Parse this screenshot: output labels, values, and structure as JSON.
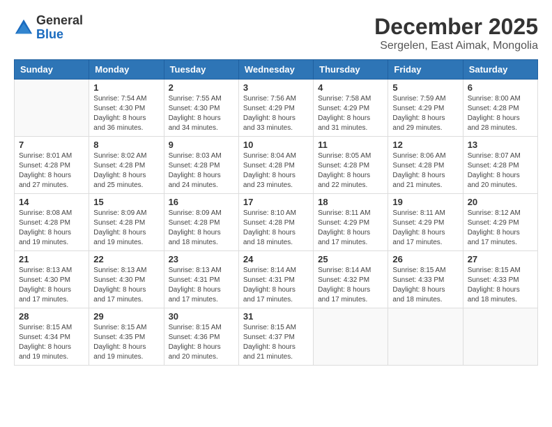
{
  "header": {
    "logo_general": "General",
    "logo_blue": "Blue",
    "month_title": "December 2025",
    "subtitle": "Sergelen, East Aimak, Mongolia"
  },
  "weekdays": [
    "Sunday",
    "Monday",
    "Tuesday",
    "Wednesday",
    "Thursday",
    "Friday",
    "Saturday"
  ],
  "weeks": [
    [
      {
        "day": "",
        "sunrise": "",
        "sunset": "",
        "daylight": ""
      },
      {
        "day": "1",
        "sunrise": "Sunrise: 7:54 AM",
        "sunset": "Sunset: 4:30 PM",
        "daylight": "Daylight: 8 hours and 36 minutes."
      },
      {
        "day": "2",
        "sunrise": "Sunrise: 7:55 AM",
        "sunset": "Sunset: 4:30 PM",
        "daylight": "Daylight: 8 hours and 34 minutes."
      },
      {
        "day": "3",
        "sunrise": "Sunrise: 7:56 AM",
        "sunset": "Sunset: 4:29 PM",
        "daylight": "Daylight: 8 hours and 33 minutes."
      },
      {
        "day": "4",
        "sunrise": "Sunrise: 7:58 AM",
        "sunset": "Sunset: 4:29 PM",
        "daylight": "Daylight: 8 hours and 31 minutes."
      },
      {
        "day": "5",
        "sunrise": "Sunrise: 7:59 AM",
        "sunset": "Sunset: 4:29 PM",
        "daylight": "Daylight: 8 hours and 29 minutes."
      },
      {
        "day": "6",
        "sunrise": "Sunrise: 8:00 AM",
        "sunset": "Sunset: 4:28 PM",
        "daylight": "Daylight: 8 hours and 28 minutes."
      }
    ],
    [
      {
        "day": "7",
        "sunrise": "Sunrise: 8:01 AM",
        "sunset": "Sunset: 4:28 PM",
        "daylight": "Daylight: 8 hours and 27 minutes."
      },
      {
        "day": "8",
        "sunrise": "Sunrise: 8:02 AM",
        "sunset": "Sunset: 4:28 PM",
        "daylight": "Daylight: 8 hours and 25 minutes."
      },
      {
        "day": "9",
        "sunrise": "Sunrise: 8:03 AM",
        "sunset": "Sunset: 4:28 PM",
        "daylight": "Daylight: 8 hours and 24 minutes."
      },
      {
        "day": "10",
        "sunrise": "Sunrise: 8:04 AM",
        "sunset": "Sunset: 4:28 PM",
        "daylight": "Daylight: 8 hours and 23 minutes."
      },
      {
        "day": "11",
        "sunrise": "Sunrise: 8:05 AM",
        "sunset": "Sunset: 4:28 PM",
        "daylight": "Daylight: 8 hours and 22 minutes."
      },
      {
        "day": "12",
        "sunrise": "Sunrise: 8:06 AM",
        "sunset": "Sunset: 4:28 PM",
        "daylight": "Daylight: 8 hours and 21 minutes."
      },
      {
        "day": "13",
        "sunrise": "Sunrise: 8:07 AM",
        "sunset": "Sunset: 4:28 PM",
        "daylight": "Daylight: 8 hours and 20 minutes."
      }
    ],
    [
      {
        "day": "14",
        "sunrise": "Sunrise: 8:08 AM",
        "sunset": "Sunset: 4:28 PM",
        "daylight": "Daylight: 8 hours and 19 minutes."
      },
      {
        "day": "15",
        "sunrise": "Sunrise: 8:09 AM",
        "sunset": "Sunset: 4:28 PM",
        "daylight": "Daylight: 8 hours and 19 minutes."
      },
      {
        "day": "16",
        "sunrise": "Sunrise: 8:09 AM",
        "sunset": "Sunset: 4:28 PM",
        "daylight": "Daylight: 8 hours and 18 minutes."
      },
      {
        "day": "17",
        "sunrise": "Sunrise: 8:10 AM",
        "sunset": "Sunset: 4:28 PM",
        "daylight": "Daylight: 8 hours and 18 minutes."
      },
      {
        "day": "18",
        "sunrise": "Sunrise: 8:11 AM",
        "sunset": "Sunset: 4:29 PM",
        "daylight": "Daylight: 8 hours and 17 minutes."
      },
      {
        "day": "19",
        "sunrise": "Sunrise: 8:11 AM",
        "sunset": "Sunset: 4:29 PM",
        "daylight": "Daylight: 8 hours and 17 minutes."
      },
      {
        "day": "20",
        "sunrise": "Sunrise: 8:12 AM",
        "sunset": "Sunset: 4:29 PM",
        "daylight": "Daylight: 8 hours and 17 minutes."
      }
    ],
    [
      {
        "day": "21",
        "sunrise": "Sunrise: 8:13 AM",
        "sunset": "Sunset: 4:30 PM",
        "daylight": "Daylight: 8 hours and 17 minutes."
      },
      {
        "day": "22",
        "sunrise": "Sunrise: 8:13 AM",
        "sunset": "Sunset: 4:30 PM",
        "daylight": "Daylight: 8 hours and 17 minutes."
      },
      {
        "day": "23",
        "sunrise": "Sunrise: 8:13 AM",
        "sunset": "Sunset: 4:31 PM",
        "daylight": "Daylight: 8 hours and 17 minutes."
      },
      {
        "day": "24",
        "sunrise": "Sunrise: 8:14 AM",
        "sunset": "Sunset: 4:31 PM",
        "daylight": "Daylight: 8 hours and 17 minutes."
      },
      {
        "day": "25",
        "sunrise": "Sunrise: 8:14 AM",
        "sunset": "Sunset: 4:32 PM",
        "daylight": "Daylight: 8 hours and 17 minutes."
      },
      {
        "day": "26",
        "sunrise": "Sunrise: 8:15 AM",
        "sunset": "Sunset: 4:33 PM",
        "daylight": "Daylight: 8 hours and 18 minutes."
      },
      {
        "day": "27",
        "sunrise": "Sunrise: 8:15 AM",
        "sunset": "Sunset: 4:33 PM",
        "daylight": "Daylight: 8 hours and 18 minutes."
      }
    ],
    [
      {
        "day": "28",
        "sunrise": "Sunrise: 8:15 AM",
        "sunset": "Sunset: 4:34 PM",
        "daylight": "Daylight: 8 hours and 19 minutes."
      },
      {
        "day": "29",
        "sunrise": "Sunrise: 8:15 AM",
        "sunset": "Sunset: 4:35 PM",
        "daylight": "Daylight: 8 hours and 19 minutes."
      },
      {
        "day": "30",
        "sunrise": "Sunrise: 8:15 AM",
        "sunset": "Sunset: 4:36 PM",
        "daylight": "Daylight: 8 hours and 20 minutes."
      },
      {
        "day": "31",
        "sunrise": "Sunrise: 8:15 AM",
        "sunset": "Sunset: 4:37 PM",
        "daylight": "Daylight: 8 hours and 21 minutes."
      },
      {
        "day": "",
        "sunrise": "",
        "sunset": "",
        "daylight": ""
      },
      {
        "day": "",
        "sunrise": "",
        "sunset": "",
        "daylight": ""
      },
      {
        "day": "",
        "sunrise": "",
        "sunset": "",
        "daylight": ""
      }
    ]
  ]
}
